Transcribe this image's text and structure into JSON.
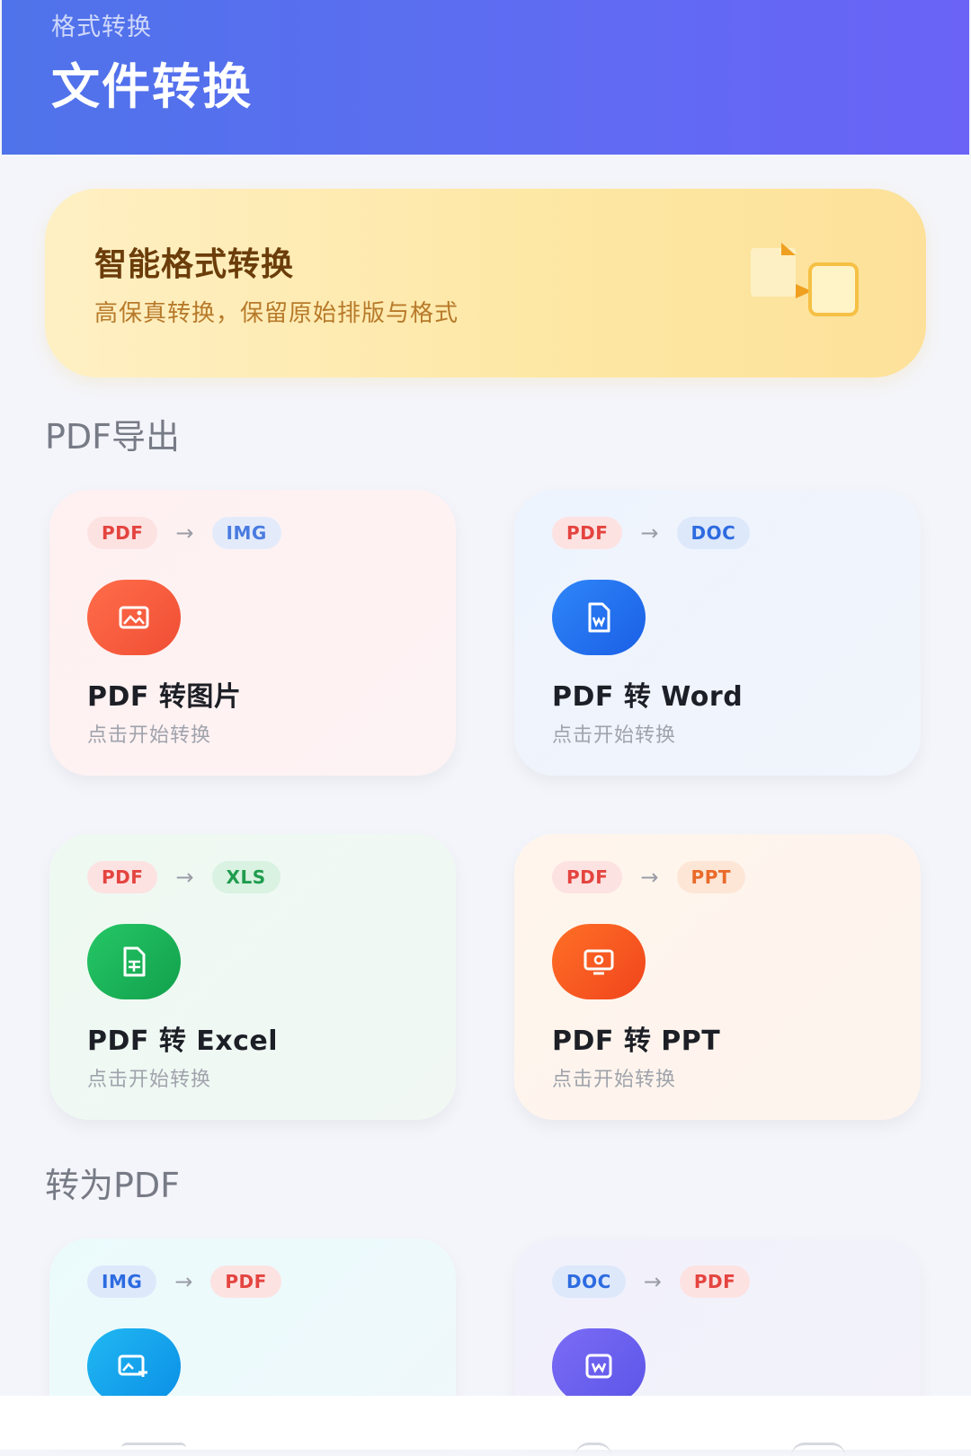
{
  "header": {
    "subtitle": "格式转换",
    "title": "文件转换"
  },
  "banner": {
    "title": "智能格式转换",
    "subtitle": "高保真转换，保留原始排版与格式"
  },
  "sections": {
    "export": "PDF导出",
    "import": "转为PDF"
  },
  "cards": [
    {
      "from": "PDF",
      "to": "IMG",
      "arrow": "→",
      "title": "PDF 转图片",
      "hint": "点击开始转换",
      "icon": "image-icon",
      "color": "#f05a3c"
    },
    {
      "from": "PDF",
      "to": "DOC",
      "arrow": "→",
      "title": "PDF 转 Word",
      "hint": "点击开始转换",
      "icon": "word-doc-icon",
      "color": "#1f6df2"
    },
    {
      "from": "PDF",
      "to": "XLS",
      "arrow": "→",
      "title": "PDF 转 Excel",
      "hint": "点击开始转换",
      "icon": "excel-doc-icon",
      "color": "#1ab459"
    },
    {
      "from": "PDF",
      "to": "PPT",
      "arrow": "→",
      "title": "PDF 转 PPT",
      "hint": "点击开始转换",
      "icon": "presentation-icon",
      "color": "#f55a1e"
    },
    {
      "from": "IMG",
      "to": "PDF",
      "arrow": "→",
      "icon": "image-add-icon",
      "color": "#12a6ec"
    },
    {
      "from": "DOC",
      "to": "PDF",
      "arrow": "→",
      "icon": "word-doc-icon",
      "color": "#6a5df2"
    }
  ],
  "colors": {
    "header": "#5a6df0",
    "pdf_tag": "#e4443f",
    "img_tag": "#4a7ce0",
    "doc_tag": "#2d6be0",
    "xls_tag": "#1f9d4e",
    "ppt_tag": "#ea6a2a"
  }
}
